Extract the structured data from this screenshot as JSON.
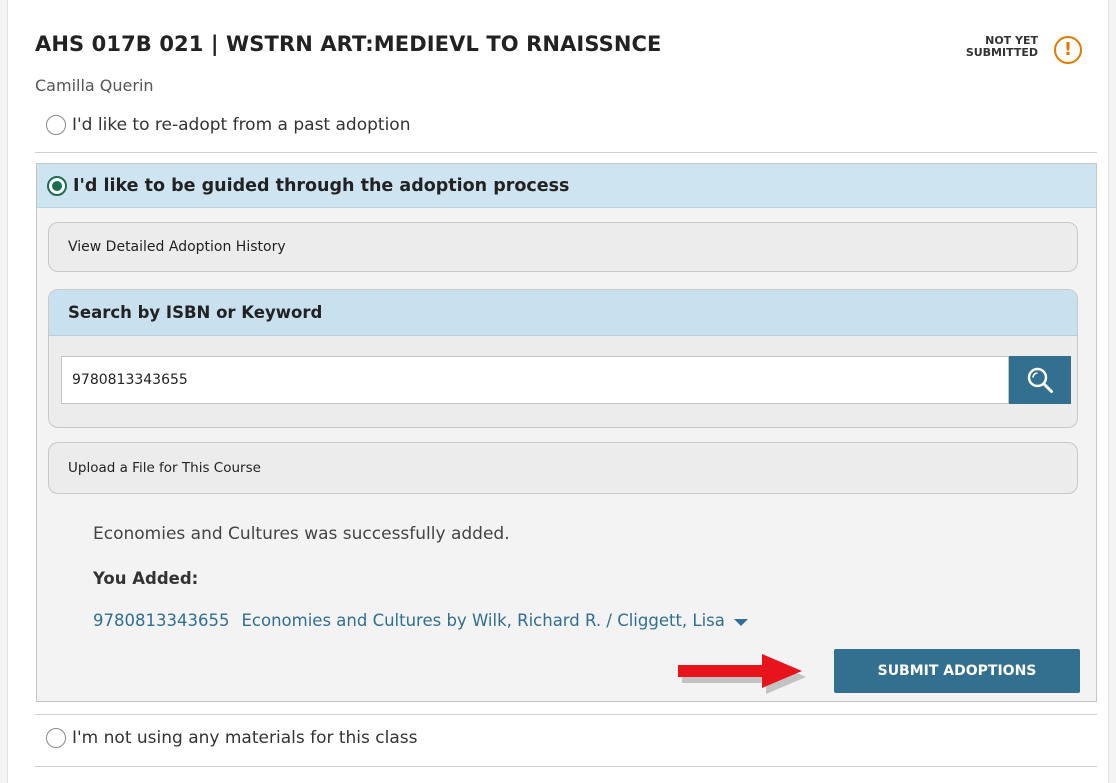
{
  "course": {
    "title": "AHS 017B 021 | WSTRN ART:MEDIEVL TO RNAISSNCE",
    "instructor": "Camilla Querin",
    "status_line1": "NOT YET",
    "status_line2": "SUBMITTED",
    "status_icon": "!"
  },
  "options": {
    "readopt_label": "I'd like to re-adopt from a past adoption",
    "guided_label": "I'd like to be guided through the adoption process",
    "not_using_label": "I'm not using any materials for this class"
  },
  "guided": {
    "history_label": "View Detailed Adoption History",
    "search_header": "Search by ISBN or Keyword",
    "search_value": "9780813343655",
    "upload_label": "Upload a File for This Course",
    "success_message": "Economies and Cultures was successfully added.",
    "added_label": "You Added:",
    "added_isbn": "9780813343655",
    "added_title": "Economies and Cultures by Wilk, Richard R. / Cliggett, Lisa",
    "submit_label": "SUBMIT ADOPTIONS"
  },
  "colors": {
    "accent": "#336f8f",
    "header_blue": "#cfe4f1",
    "warning": "#e07b00",
    "radio_checked": "#1a6e4e",
    "link": "#2f6f93",
    "annotation_arrow": "#e8141c"
  },
  "icons": {
    "status": "warning-circle-icon",
    "search": "search-icon",
    "caret": "chevron-down-icon",
    "arrow": "red-arrow-annotation"
  }
}
